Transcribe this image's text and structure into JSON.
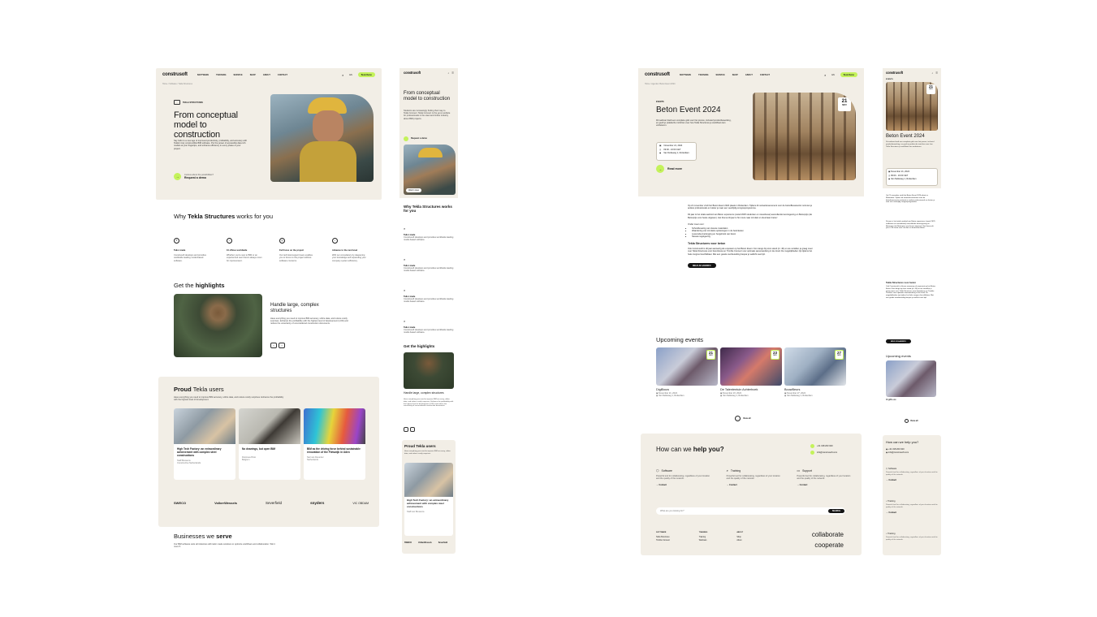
{
  "logo": "construsoft",
  "nav": {
    "items": [
      "SOFTWARE",
      "TRAINING",
      "SERVICE",
      "SHOP",
      "ABOUT",
      "CONTACT"
    ],
    "lang": "EN",
    "cta": "Book Demo"
  },
  "home": {
    "breadcrumb": "Home / Software / Tekla Structures",
    "badge": "TEKLA STRUCTURES",
    "title": "From conceptual model to construction",
    "intro": "Say hello to a new age of improved productivity, profitability, and accuracy with Tekla's truly constructible BIM software. Put the power of accessible data rich models at your fingertips, and enhance efficiency in every phase of your project.",
    "cta_question": "Curious about the possibilities?",
    "cta_label": "Request a demo",
    "why_title_a": "Why ",
    "why_title_b": "Tekla Structures",
    " why_title_c": " works for you",
    "features": [
      {
        "title": "Tailor made",
        "text": "Construsoft develops and provides worldwide leading model-based software."
      },
      {
        "title": "10 offices worldwide",
        "text": "Whether you're new to BIM or an experienced user there's always room for improvement."
      },
      {
        "title": "Full focus on the project",
        "text": "Our technical support team enables you to focus on the project without software concerns."
      },
      {
        "title": "Advance to the next level",
        "text": "With our consultancy by deepening your knowledge and expanding your company system efficiency."
      }
    ],
    "highlights_a": "Get the ",
    "highlights_b": "highlights",
    "hl_title": "Handle large, complex structures",
    "hl_text": "Have everything you need to improve BIM accuracy, utilize data, and reduce costly surprises. Enhance the profitability with the highest level of development (LOD) and reduce the uncertainty of unconsidered construction documents.",
    "proud_a": "Proud ",
    "proud_b": "Tekla users",
    "proud_text": "Have everything you need to improve BIM accuracy, utilize data, and reduce costly surprises. Enhance the profitability with the highest level of development.",
    "cases": [
      {
        "title": "High Tech Factory: an extraordinary achievement with complex steel constructions",
        "who": "Staff Bouwens",
        "where": "Constructive Netherlands"
      },
      {
        "title": "No drawings, but open BIM",
        "who": "Dorsinea Pinto",
        "where": "Belgium"
      },
      {
        "title": "BIM as the driving force behind sustainable renovation of the Fietswijk in Uden",
        "who": "Neil van Deventer",
        "where": "Netherlands"
      }
    ],
    "logos": [
      "SWECO",
      "VolkerWessels",
      "Severfield",
      "snyders",
      "VIC OBDAM"
    ],
    "biz_a": "Businesses we ",
    "biz_b": "serve",
    "biz_text": "Our BIM software suits all industries with tailor made solutions to optimize workflows and collaboration. Win it more 5."
  },
  "mobile1": {
    "title": "From conceptual model to construction",
    "intro": "Students are increasingly finding their way to Tekla Connect. Tekla Connect is the go-to website for professionals in the steel and timber industry about BIM projects.",
    "cta": "Request a demo",
    "video": "Watch video",
    "why": "Why Tekla Structures works for you",
    "feat": [
      "Tailor made",
      "Tailor made",
      "Tailor made",
      "Tailor made"
    ],
    "feat_text": "Construsoft develops and provides worldwide leading model-based software.",
    "highlights": "Get the highlights",
    "hl_title": "Handle large, complex structures",
    "hl_text": "Have everything you need to improve BIM accuracy, utilize data, and reduce costly surprises. Enhance the profitability with the highest level of development (LOD) and reduce the uncertainty of unconsidered construction documents.",
    "proud": "Proud Tekla users",
    "proud_text": "Have everything you need to improve BIM accuracy, utilize data, and reduce costly surprises.",
    "case": "High Tech Factory: an extraordinary achievement with complex steel constructions",
    "who": "Staff van Bouwens"
  },
  "event": {
    "breadcrumb": "Home / Agenda / Beton Event 2024",
    "label": "EVENTS",
    "title": "Beton Event 2024",
    "text": "Dit webinar biedt een complete gids voor het proces, inclusief productbewerking, en geeft je praktische inzichten over hoe Tekla Structures je workflows kan verbeteren.",
    "date": "November 21, 2024",
    "time": "09:00 - 16:00 CET",
    "place": "Van Nelleweg 1, Rotterdam",
    "day": "21",
    "month": "NOV",
    "read_more": "Read more",
    "body1": "Op 21 november vindt het Beton Event 2024 plaats in Rotterdam. Tijdens dit netwerkevenement voor de betonBouwsector ontmoet je andere professionals en luister je naar een veelzijdig congresprogramma.",
    "body2": "Dit jaar is het totale aanbod van Beton experience (vanaf 2025 studenten en nieuwbouw) aanvullende kennisgeving en Betonprijs (de Betonprijs voor beste uitgaven). Het thema dit jaar is 'En route naar circulair en duurzaam beton'.",
    "onder": "Onder meer over:",
    "bullets": [
      "Schoolbouwing van nieuwe materialen",
      "Waardering van circulaire oplossingen in de betonketen",
      "Levensduurverlenging en hergebruik van beton",
      "Nieuwe regelgeving"
    ],
    "tekla_title": "Tekla Structures voor beton",
    "tekla_text": "Ook Construsoft is dit jaar aanwezig als exposant op het Beton Event. Kom langs bij onze stand (nr. 40) en we vertellen je graag meer over Tekla Structures voor betonbouw en Trimble Connect voor optimale samenwerking in de cloud. De mogelijkheden zijn tijdens het hele congres beschikbaar. Met een goede voorbereiding bespar je wellicht veel tijd.",
    "register": "MELD JE AAN/INFO",
    "upcoming": "Upcoming events",
    "events": [
      {
        "name": "DigiBouw",
        "date": "November 21, 2024",
        "place": "Van Nelleweg 1, Rotterdam",
        "day": "21",
        "month": "NOV"
      },
      {
        "name": "De Talententuin Achterhoek",
        "date": "November 23, 2024",
        "place": "Van Nelleweg 1, Rotterdam",
        "day": "23",
        "month": "NOV"
      },
      {
        "name": "BouwBeurs",
        "date": "November 27, 2024",
        "place": "Van Nelleweg 1, Rotterdam",
        "day": "27",
        "month": "NOV"
      }
    ],
    "view_all": "View all",
    "help_a": "How can we ",
    "help_b": "help you?",
    "phone": "+31 318 203 020",
    "email": "info@construsoft.com",
    "help": [
      {
        "title": "Software",
        "text": "Powerful tool for collaborating, regardless of your location and the quality of the network.",
        "link": "Contact"
      },
      {
        "title": "Training",
        "text": "Powerful tool for collaborating, regardless of your location and the quality of the network.",
        "link": "Contact"
      },
      {
        "title": "Support",
        "text": "Powerful tool for collaborating, regardless of your location and the quality of the network.",
        "link": "Contact"
      }
    ],
    "search_placeholder": "What are you looking for?",
    "search_btn": "SEARCH",
    "footer": [
      {
        "head": "SOFTWARE",
        "items": [
          "Tekla Structures",
          "Trimble Connect"
        ]
      },
      {
        "head": "TRAINING",
        "items": [
          "Training",
          "Webinars"
        ]
      },
      {
        "head": "ABOUT",
        "items": [
          "Shop",
          "About"
        ]
      }
    ],
    "tag1": "collaborate",
    "tag2": "cooperate"
  },
  "mobile2": {
    "label": "EVENTS",
    "title": "Beton Event 2024",
    "text": "Dit webinar biedt een complete gids voor het proces, inclusief productbewerking, en geeft je praktische inzichten over hoe Tekla Structures je workflows kan verbeteren.",
    "date": "November 21, 2024",
    "time": "09:00 - 16:00 CET",
    "place": "Van Nelleweg 1, Rotterdam",
    "day": "21",
    "month": "NOV",
    "body": "Op 21 november vindt het Beton Event 2024 plaats in Rotterdam. Tijdens dit netwerkevenement voor de betonbouwsector ontmoet je andere professionals en luister je naar een veelzijdig congresprogramma.",
    "tekla_title": "Tekla Structures voor beton",
    "register": "MELD JE AAN/INFO",
    "upcoming": "Upcoming events",
    "ev_name": "DigiBouw",
    "view_all": "View all",
    "help": "How can we help you?",
    "phone": "+31 318 203 020",
    "email": "info@construsoft.com",
    "items": [
      "Software",
      "Training",
      "Training"
    ],
    "item_text": "Powerful tool for collaborating, regardless of your location and the quality of the network.",
    "contact": "Contact"
  }
}
